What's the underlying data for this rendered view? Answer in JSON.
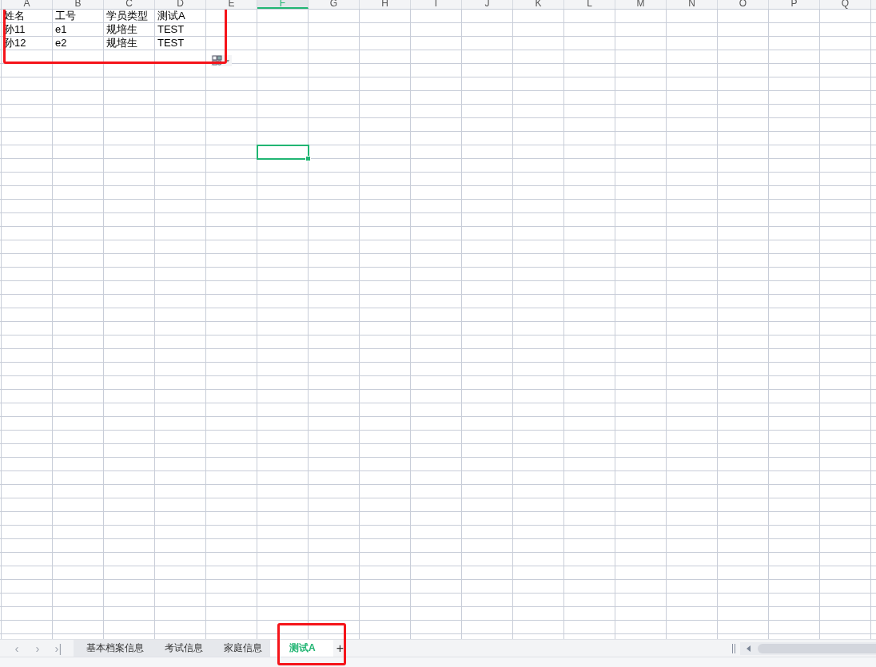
{
  "columns": [
    {
      "label": "A",
      "selected": false
    },
    {
      "label": "B",
      "selected": false
    },
    {
      "label": "C",
      "selected": false
    },
    {
      "label": "D",
      "selected": false
    },
    {
      "label": "E",
      "selected": false
    },
    {
      "label": "F",
      "selected": true
    },
    {
      "label": "G",
      "selected": false
    },
    {
      "label": "H",
      "selected": false
    },
    {
      "label": "I",
      "selected": false
    },
    {
      "label": "J",
      "selected": false
    },
    {
      "label": "K",
      "selected": false
    },
    {
      "label": "L",
      "selected": false
    },
    {
      "label": "M",
      "selected": false
    },
    {
      "label": "N",
      "selected": false
    },
    {
      "label": "O",
      "selected": false
    },
    {
      "label": "P",
      "selected": false
    },
    {
      "label": "Q",
      "selected": false
    }
  ],
  "rows": [
    [
      "姓名",
      "工号",
      "学员类型",
      "测试A"
    ],
    [
      "孙11",
      "e1",
      "规培生",
      "TEST"
    ],
    [
      "孙12",
      "e2",
      "规培生",
      "TEST"
    ]
  ],
  "sheet_nav": [
    "‹",
    "›",
    "›|"
  ],
  "tabs": [
    {
      "label": "基本档案信息",
      "selected": false
    },
    {
      "label": "考试信息",
      "selected": false
    },
    {
      "label": "家庭信息",
      "selected": false
    },
    {
      "label": "测试A",
      "selected": true
    }
  ],
  "add_tab": "+"
}
